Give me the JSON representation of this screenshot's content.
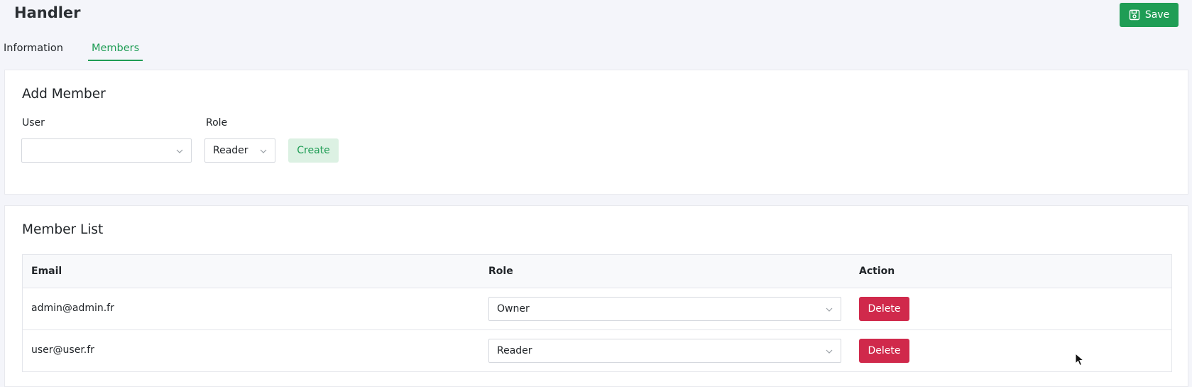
{
  "header": {
    "title": "Handler",
    "save_label": "Save"
  },
  "tabs": [
    {
      "label": "Information",
      "active": false
    },
    {
      "label": "Members",
      "active": true
    }
  ],
  "add_member": {
    "title": "Add Member",
    "user_label": "User",
    "user_value": "",
    "role_label": "Role",
    "role_value": "Reader",
    "create_label": "Create"
  },
  "member_list": {
    "title": "Member List",
    "columns": [
      "Email",
      "Role",
      "Action"
    ],
    "rows": [
      {
        "email": "admin@admin.fr",
        "role": "Owner",
        "action": "Delete"
      },
      {
        "email": "user@user.fr",
        "role": "Reader",
        "action": "Delete"
      }
    ]
  },
  "colors": {
    "primary": "#1f9d55",
    "primary_light": "#dcf1e3",
    "danger": "#d0294b",
    "background": "#f4f5fa"
  },
  "icons": {
    "save": "floppy-disk-icon",
    "dropdown": "chevron-down-icon",
    "cursor": "mouse-pointer-icon"
  }
}
